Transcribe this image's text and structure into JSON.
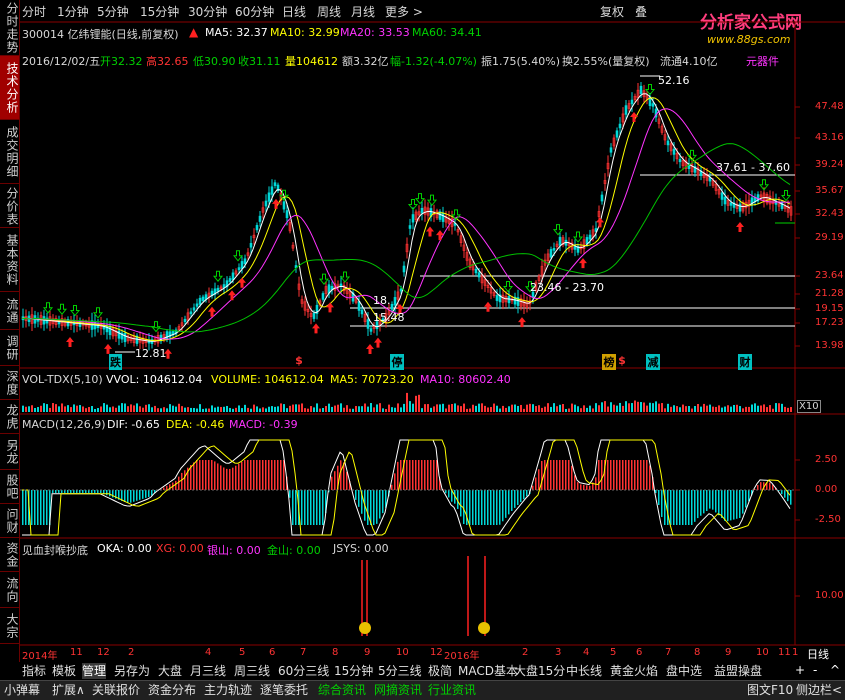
{
  "sidebar": {
    "tabs": [
      {
        "label": "分时走势",
        "active": false
      },
      {
        "label": "技术分析",
        "active": true
      },
      {
        "label": "成交明细",
        "active": false
      },
      {
        "label": "分价表",
        "active": false
      },
      {
        "label": "基本资料",
        "active": false
      },
      {
        "label": "流通",
        "active": false
      },
      {
        "label": "调研",
        "active": false
      },
      {
        "label": "深度",
        "active": false
      },
      {
        "label": "龙虎",
        "active": false
      },
      {
        "label": "另龙",
        "active": false
      },
      {
        "label": "股吧",
        "active": false
      },
      {
        "label": "问财",
        "active": false
      },
      {
        "label": "资金",
        "active": false
      },
      {
        "label": "流向",
        "active": false
      },
      {
        "label": "大宗",
        "active": false
      }
    ]
  },
  "period_tabs": [
    {
      "label": "分时",
      "active": true
    },
    {
      "label": "1分钟",
      "active": false
    },
    {
      "label": "5分钟",
      "active": false
    },
    {
      "label": "15分钟",
      "active": false
    },
    {
      "label": "30分钟",
      "active": false
    },
    {
      "label": "60分钟",
      "active": false
    },
    {
      "label": "日线",
      "active": false
    },
    {
      "label": "周线",
      "active": false
    },
    {
      "label": "月线",
      "active": false
    },
    {
      "label": "更多 >",
      "active": false
    }
  ],
  "header_buttons": {
    "restore": "复权",
    "overlay": "叠"
  },
  "logo": {
    "name": "分析家公式网",
    "url": "www.88gs.com"
  },
  "stock_info": {
    "title": "300014 亿纬锂能(日线,前复权)",
    "ma5": "MA5: 32.37",
    "ma10": "MA10: 32.99",
    "ma20": "MA20: 33.53",
    "ma60": "MA60: 34.41",
    "tag": "元器件"
  },
  "quote": {
    "date": "2016/12/02/五",
    "open": "开32.32",
    "high": "高32.65",
    "low": "低30.90",
    "close": "收31.11",
    "vol": "量104612",
    "amount": "额3.32亿",
    "change": "幅-1.32(-4.07%)",
    "amplitude": "振1.75(5.40%)",
    "turnover": "换2.55%(量复权)",
    "float": "流通4.10亿"
  },
  "price_axis": [
    "47.48",
    "43.16",
    "39.24",
    "35.67",
    "32.43",
    "29.19",
    "23.64",
    "21.28",
    "19.15",
    "17.23",
    "13.98"
  ],
  "annotations": {
    "peak": "52.16",
    "range1": "37.61 - 37.60",
    "range2": "23.46 - 23.70",
    "low": "12.81",
    "mid1": "18.",
    "mid2": "15.48"
  },
  "event_markers": [
    "跌",
    "$",
    "停",
    "榜",
    "$",
    "减",
    "财"
  ],
  "volume_panel": {
    "name": "VOL-TDX(5,10)",
    "vvol": "VVOL: 104612.04",
    "volume": "VOLUME: 104612.04",
    "ma5": "MA5: 70723.20",
    "ma10": "MA10: 80602.40",
    "scale": "X10"
  },
  "macd_panel": {
    "name": "MACD(12,26,9)",
    "dif": "DIF: -0.65",
    "dea": "DEA: -0.46",
    "macd": "MACD: -0.39",
    "axis": [
      "2.50",
      "0.00",
      "-2.50"
    ]
  },
  "custom_panel": {
    "name": "见血封喉抄底",
    "oka": "OKA: 0.00",
    "xg": "XG: 0.00",
    "silver": "银山: 0.00",
    "gold": "金山: 0.00",
    "jsys": "JSYS: 0.00",
    "axis": [
      "10.00"
    ]
  },
  "time_axis": [
    "2014年",
    "11",
    "12",
    "2",
    "4",
    "5",
    "6",
    "7",
    "8",
    "9",
    "10",
    "12",
    "2016年",
    "2",
    "3",
    "4",
    "5",
    "6",
    "7",
    "8",
    "9",
    "10",
    "11",
    "1"
  ],
  "time_mode": "日线",
  "bottom_tabs": [
    {
      "label": "指标",
      "active": false
    },
    {
      "label": "模板",
      "active": false
    },
    {
      "label": "管理",
      "active": true
    },
    {
      "label": "另存为",
      "active": false
    },
    {
      "label": "大盘",
      "active": false
    },
    {
      "label": "月三线",
      "active": false
    },
    {
      "label": "周三线",
      "active": false
    },
    {
      "label": "60分三线",
      "active": false
    },
    {
      "label": "15分钟",
      "active": false
    },
    {
      "label": "5分三线",
      "active": false
    },
    {
      "label": "极简",
      "active": false
    },
    {
      "label": "MACD基本",
      "active": false
    },
    {
      "label": "大盘15分",
      "active": false
    },
    {
      "label": "中长线",
      "active": false
    },
    {
      "label": "黄金火焰",
      "active": false
    },
    {
      "label": "盘中选",
      "active": false
    },
    {
      "label": "益盟操盘",
      "active": false
    }
  ],
  "nav_arrows": {
    "plus": "+",
    "minus": "-",
    "up": "^"
  },
  "footer_tabs": [
    {
      "label": "小弹幕",
      "green": false
    },
    {
      "label": "扩展∧",
      "green": false
    },
    {
      "label": "关联报价",
      "green": false
    },
    {
      "label": "资金分布",
      "green": false
    },
    {
      "label": "主力轨迹",
      "green": false
    },
    {
      "label": "逐笔委托",
      "green": false
    },
    {
      "label": "综合资讯",
      "green": true
    },
    {
      "label": "网摘资讯",
      "green": true
    },
    {
      "label": "行业资讯",
      "green": true
    }
  ],
  "footer_right": {
    "graph": "图文F10",
    "sidebar": "侧边栏<"
  },
  "colors": {
    "up": "#ff3333",
    "down": "#00d8d8",
    "ma5": "#ffffff",
    "ma10": "#ffff00",
    "ma20": "#ff33ff",
    "ma60": "#00c000",
    "accent": "#a00000"
  }
}
